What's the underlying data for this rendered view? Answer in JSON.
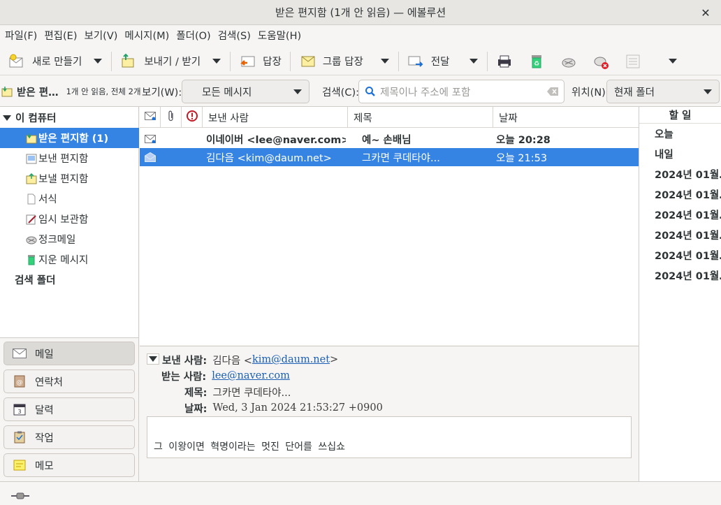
{
  "window": {
    "title": "받은 편지함 (1개 안 읽음) — 에볼루션"
  },
  "menubar": [
    "파일(F)",
    "편집(E)",
    "보기(V)",
    "메시지(M)",
    "폴더(O)",
    "검색(S)",
    "도움말(H)"
  ],
  "toolbar": {
    "new": "새로 만들기",
    "send_receive": "보내기 / 받기",
    "reply": "답장",
    "group_reply": "그룹 답장",
    "forward": "전달"
  },
  "searchbar": {
    "folder_name": "받은 편…",
    "folder_counts": "1개 안 읽음, 전체 2개",
    "view_label": "보기(W):",
    "view_value": "모든 메시지",
    "search_label": "검색(C):",
    "search_placeholder": "제목이나 주소에 포함",
    "location_label": "위치(N)",
    "location_value": "현재 폴더"
  },
  "folders": {
    "account": "이 컴퓨터",
    "items": [
      {
        "label": "받은 편지함 (1)",
        "icon": "inbox-icon"
      },
      {
        "label": "보낸 편지함",
        "icon": "outbox-icon"
      },
      {
        "label": "보낼 편지함",
        "icon": "sent-icon"
      },
      {
        "label": "서식",
        "icon": "template-icon"
      },
      {
        "label": "임시 보관함",
        "icon": "drafts-icon"
      },
      {
        "label": "정크메일",
        "icon": "junk-icon"
      },
      {
        "label": "지운 메시지",
        "icon": "trash-icon"
      }
    ],
    "search_folders": "검색 폴더"
  },
  "switcher": [
    "메일",
    "연락처",
    "달력",
    "작업",
    "메모"
  ],
  "message_list": {
    "columns": {
      "from": "보낸 사람",
      "subject": "제목",
      "date": "날짜"
    },
    "rows": [
      {
        "from": "이네이버 <lee@naver.com>",
        "subject": "예~ 손배님",
        "date": "오늘 20:28",
        "unread": true
      },
      {
        "from": "김다음 <kim@daum.net>",
        "subject": "그카면 쿠데타야...",
        "date": "오늘 21:53",
        "unread": false
      }
    ]
  },
  "preview": {
    "from_label": "보낸 사람:",
    "from_name": "김다음 <",
    "from_email": "kim@daum.net",
    "from_close": ">",
    "to_label": "받는 사람:",
    "to_email": "lee@naver.com",
    "subject_label": "제목:",
    "subject": "그카면 쿠데타야...",
    "date_label": "날짜:",
    "date": "Wed, 3 Jan 2024 21:53:27 +0900",
    "body": "그 이왕이면 혁명이라는 멋진 단어를 쓰십쇼"
  },
  "todo": {
    "title": "할 일",
    "items": [
      "오늘",
      "내일",
      "2024년 01월…",
      "2024년 01월…",
      "2024년 01월…",
      "2024년 01월…",
      "2024년 01월…",
      "2024년 01월…"
    ]
  },
  "colors": {
    "selection": "#3584e4",
    "link": "#1a5fb4",
    "important": "#c01c28"
  }
}
